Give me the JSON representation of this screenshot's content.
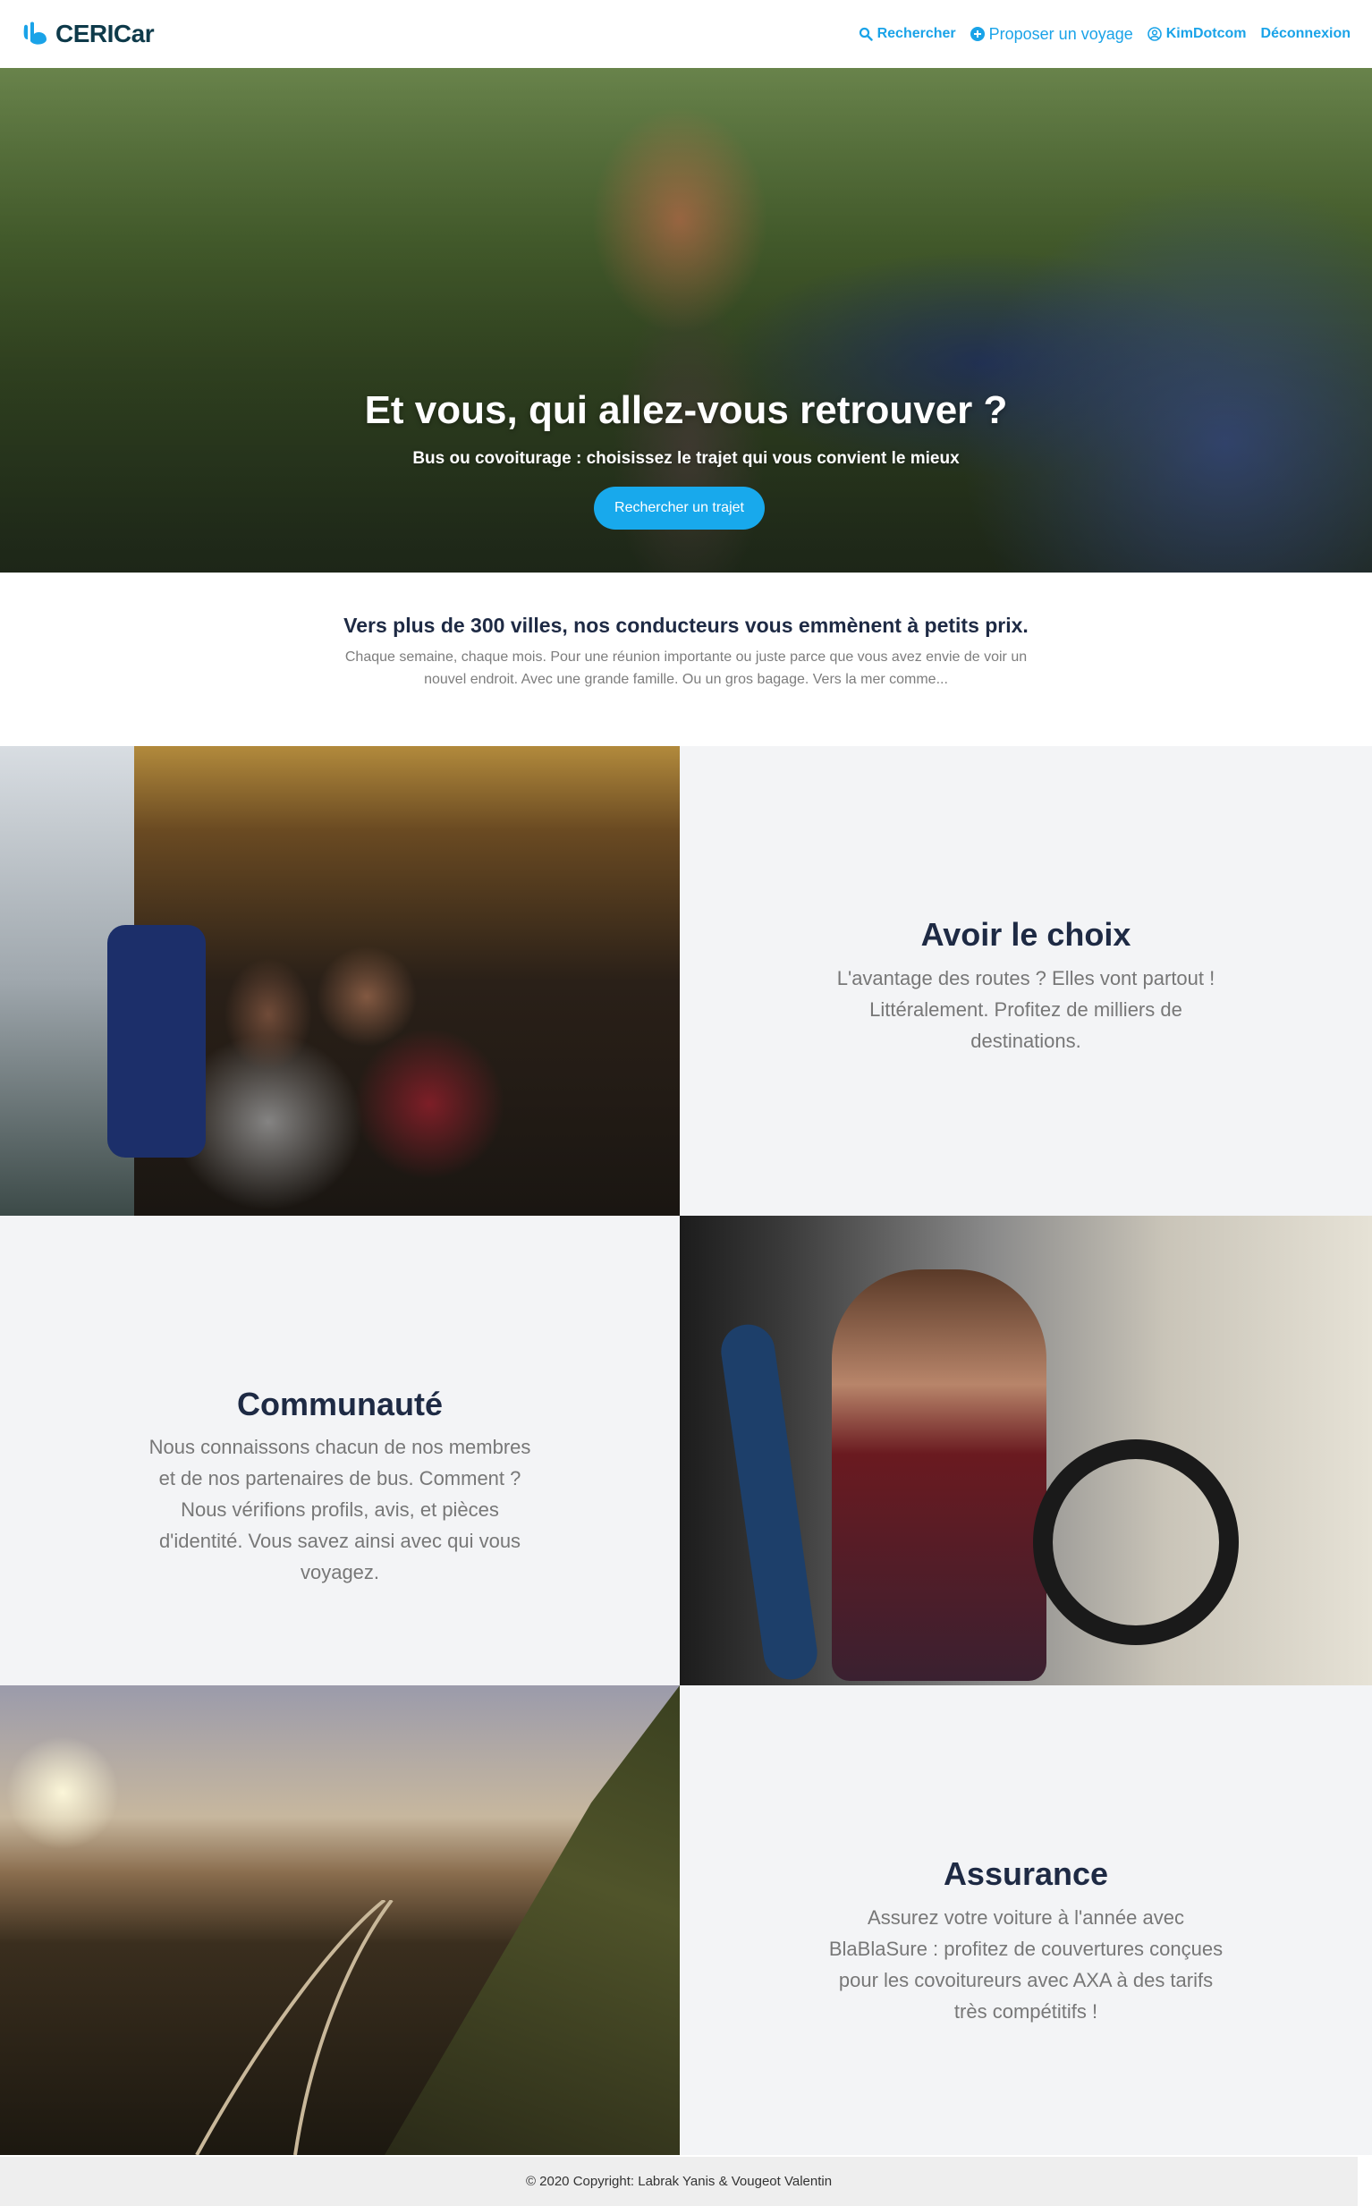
{
  "navbar": {
    "brand": "CERICar",
    "links": [
      {
        "label": "Rechercher",
        "icon": "search-icon"
      },
      {
        "label": "Proposer un voyage",
        "icon": "plus-circle-icon"
      },
      {
        "label": "KimDotcom",
        "icon": "user-circle-icon"
      },
      {
        "label": "Déconnexion",
        "icon": ""
      }
    ]
  },
  "hero": {
    "title": "Et vous, qui allez-vous retrouver ?",
    "subtitle": "Bus ou covoiturage : choisissez le trajet qui vous convient le mieux",
    "button": "Rechercher un trajet"
  },
  "intro": {
    "title": "Vers plus de 300 villes, nos conducteurs vous emmènent à petits prix.",
    "text": "Chaque semaine, chaque mois. Pour une réunion importante ou juste parce que vous avez envie de voir un nouvel endroit. Avec une grande famille. Ou un gros bagage. Vers la mer comme..."
  },
  "features": [
    {
      "title": "Avoir le choix",
      "description": "L'avantage des routes ? Elles vont partout ! Littéralement. Profitez de milliers de destinations."
    },
    {
      "title": "Communauté",
      "description": "Nous connaissons chacun de nos membres et de nos partenaires de bus. Comment ? Nous vérifions profils, avis, et pièces d'identité. Vous savez ainsi avec qui vous voyagez."
    },
    {
      "title": "Assurance",
      "description": "Assurez votre voiture à l'année avec BlaBlaSure : profitez de couvertures conçues pour les covoitureurs avec AXA à des tarifs très compétitifs !"
    }
  ],
  "footer": {
    "copyright": "© 2020 Copyright: Labrak Yanis & Vougeot Valentin"
  },
  "colors": {
    "accent": "#18a9ec",
    "heading": "#1e2a44",
    "feature_bg": "#f3f4f6"
  }
}
